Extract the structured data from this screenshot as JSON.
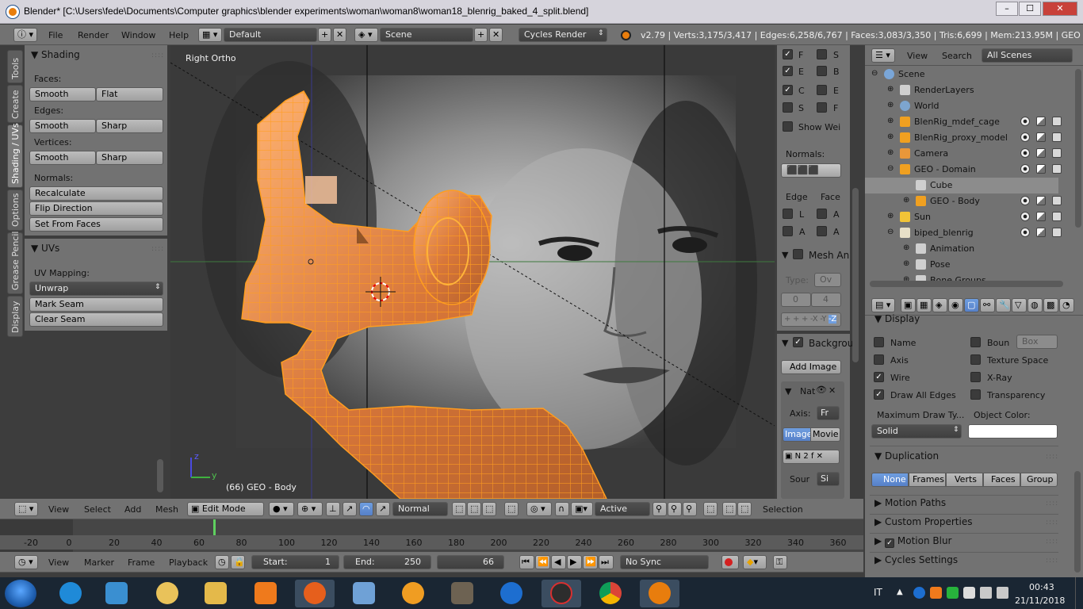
{
  "window": {
    "title": "Blender* [C:\\Users\\fede\\Documents\\Computer graphics\\blender experiments\\woman\\woman8\\woman18_blenrig_baked_4_split.blend]",
    "minimize": "–",
    "maximize": "☐",
    "close": "✕"
  },
  "info_header": {
    "menus": [
      "File",
      "Render",
      "Window",
      "Help"
    ],
    "layout": "Default",
    "scene": "Scene",
    "engine": "Cycles Render",
    "stats": "v2.79 | Verts:3,175/3,417 | Edges:6,258/6,767 | Faces:3,083/3,350 | Tris:6,699 | Mem:213.95M | GEO - Bod"
  },
  "toolshelf": {
    "tabs": [
      "Tools",
      "Create",
      "Shading / UVs",
      "Options",
      "Grease Pencil",
      "Display"
    ],
    "active_tab": "Shading / UVs",
    "shading": {
      "title": "Shading",
      "faces_label": "Faces:",
      "faces": [
        "Smooth",
        "Flat"
      ],
      "edges_label": "Edges:",
      "edges": [
        "Smooth",
        "Sharp"
      ],
      "vertices_label": "Vertices:",
      "vertices": [
        "Smooth",
        "Sharp"
      ],
      "normals_label": "Normals:",
      "normals": [
        "Recalculate",
        "Flip Direction",
        "Set From Faces"
      ]
    },
    "uvs": {
      "title": "UVs",
      "mapping_label": "UV Mapping:",
      "unwrap": "Unwrap",
      "mark_seam": "Mark Seam",
      "clear_seam": "Clear Seam"
    }
  },
  "viewport": {
    "view_label": "Right Ortho",
    "object_label": "(66) GEO - Body",
    "axis_z": "z",
    "axis_y": "y",
    "header": {
      "menus": [
        "View",
        "Select",
        "Add",
        "Mesh"
      ],
      "mode": "Edit Mode",
      "orientation": "Normal",
      "pivot": "Active",
      "selection_label": "Selection"
    }
  },
  "properties_region": {
    "flags": [
      {
        "label": "F",
        "checked": true
      },
      {
        "label": "S",
        "checked": false
      },
      {
        "label": "E",
        "checked": true
      },
      {
        "label": "B",
        "checked": false
      },
      {
        "label": "C",
        "checked": true
      },
      {
        "label": "E",
        "checked": false
      },
      {
        "label": "S",
        "checked": false
      },
      {
        "label": "F",
        "checked": false
      }
    ],
    "show_weights": "Show Wei",
    "normals_label": "Normals:",
    "edge_label": "Edge",
    "face_label": "Face",
    "edge_flags": [
      "L",
      "A"
    ],
    "face_flags": [
      "A",
      "A"
    ],
    "mesh_analysis": "Mesh An",
    "type_label": "Type:",
    "type_value": "Ov",
    "range": [
      "0",
      "4"
    ],
    "axis_buttons": [
      "+",
      "+",
      "+",
      "-X",
      "-Y",
      "-Z"
    ],
    "background_images": "Backgrou",
    "add_image": "Add Image",
    "image_name": "Nat",
    "axis_label": "Axis:",
    "axis_value": "Fr",
    "source_tabs": [
      "Image",
      "Movie"
    ],
    "image_users": "2",
    "image_n": "N",
    "image_f": "f",
    "source_label": "Sour",
    "source_value": "Si"
  },
  "outliner": {
    "menus": [
      "View",
      "Search"
    ],
    "filter": "All Scenes",
    "items": [
      {
        "name": "Scene",
        "indent": 0,
        "icon": "scene-icon"
      },
      {
        "name": "RenderLayers",
        "indent": 1,
        "icon": "renderlayers-icon"
      },
      {
        "name": "World",
        "indent": 1,
        "icon": "world-icon"
      },
      {
        "name": "BlenRig_mdef_cage",
        "indent": 1,
        "icon": "mesh-icon"
      },
      {
        "name": "BlenRig_proxy_model",
        "indent": 1,
        "icon": "mesh-icon"
      },
      {
        "name": "Camera",
        "indent": 1,
        "icon": "camera-icon"
      },
      {
        "name": "GEO - Domain",
        "indent": 1,
        "icon": "mesh-icon"
      },
      {
        "name": "Cube",
        "indent": 2,
        "icon": "mesh-data-icon"
      },
      {
        "name": "GEO - Body",
        "indent": 2,
        "icon": "mesh-icon"
      },
      {
        "name": "Sun",
        "indent": 1,
        "icon": "lamp-icon"
      },
      {
        "name": "biped_blenrig",
        "indent": 1,
        "icon": "armature-icon"
      },
      {
        "name": "Animation",
        "indent": 2,
        "icon": "animation-icon"
      },
      {
        "name": "Pose",
        "indent": 2,
        "icon": "pose-icon"
      },
      {
        "name": "Bone Groups",
        "indent": 2,
        "icon": "bone-group-icon"
      }
    ]
  },
  "properties": {
    "display": {
      "title": "Display",
      "name": {
        "label": "Name",
        "checked": false
      },
      "bounds": {
        "label": "Boun",
        "checked": false
      },
      "bounds_type": "Box",
      "axis": {
        "label": "Axis",
        "checked": false
      },
      "texture_space": {
        "label": "Texture Space",
        "checked": false
      },
      "wire": {
        "label": "Wire",
        "checked": true
      },
      "xray": {
        "label": "X-Ray",
        "checked": false
      },
      "draw_all_edges": {
        "label": "Draw All Edges",
        "checked": true
      },
      "transparency": {
        "label": "Transparency",
        "checked": false
      },
      "max_draw_label": "Maximum Draw Ty...",
      "max_draw_value": "Solid",
      "object_color_label": "Object Color:"
    },
    "duplication": {
      "title": "Duplication",
      "options": [
        "None",
        "Frames",
        "Verts",
        "Faces",
        "Group"
      ],
      "active": "None"
    },
    "collapsed": [
      "Motion Paths",
      "Custom Properties",
      "Motion Blur",
      "Cycles Settings"
    ]
  },
  "timeline": {
    "ticks": [
      "-20",
      "0",
      "20",
      "40",
      "60",
      "80",
      "100",
      "120",
      "140",
      "160",
      "180",
      "200",
      "220",
      "240",
      "260",
      "280",
      "300",
      "320",
      "340",
      "360"
    ],
    "current_frame": 66,
    "menus": [
      "View",
      "Marker",
      "Frame",
      "Playback"
    ],
    "start_label": "Start:",
    "start": "1",
    "end_label": "End:",
    "end": "250",
    "frame": "66",
    "sync": "No Sync"
  },
  "taskbar": {
    "language": "IT",
    "time": "00:43",
    "date": "21/11/2018"
  }
}
